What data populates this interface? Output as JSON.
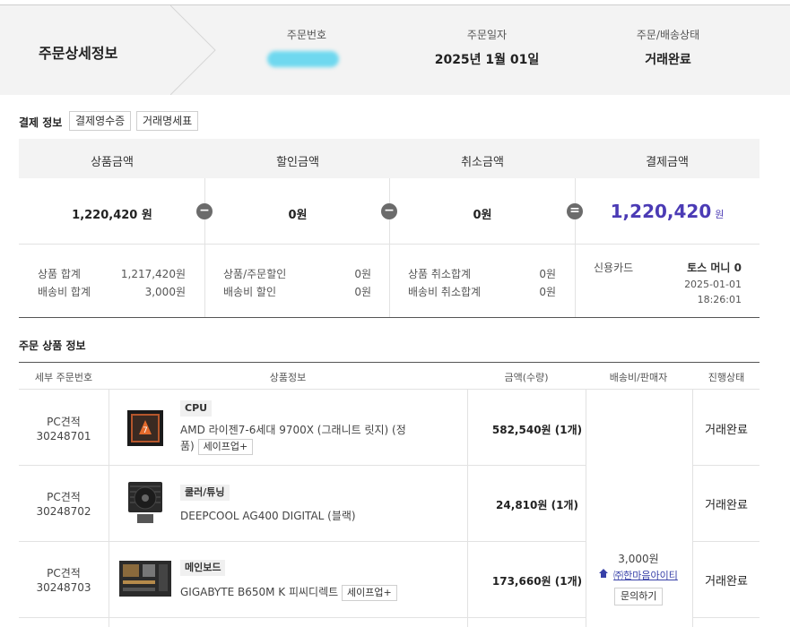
{
  "header": {
    "title": "주문상세정보",
    "order_no_label": "주문번호",
    "order_no_value": "",
    "order_date_label": "주문일자",
    "order_date_value": "2025년 1월 01일",
    "status_label": "주문/배송상태",
    "status_value": "거래완료"
  },
  "payment": {
    "title": "결제 정보",
    "receipt_button": "결제영수증",
    "statement_button": "거래명세표",
    "headers": [
      "상품금액",
      "할인금액",
      "취소금액",
      "결제금액"
    ],
    "values": {
      "product": "1,220,420 원",
      "discount": "0원",
      "cancel": "0원",
      "total": "1,220,420",
      "total_unit": "원"
    },
    "operators": [
      "−",
      "−",
      "="
    ],
    "details": {
      "product_sum_label": "상품 합계",
      "product_sum_value": "1,217,420원",
      "shipping_sum_label": "배송비 합계",
      "shipping_sum_value": "3,000원",
      "product_discount_label": "상품/주문할인",
      "product_discount_value": "0원",
      "shipping_discount_label": "배송비 할인",
      "shipping_discount_value": "0원",
      "product_cancel_label": "상품 취소합계",
      "product_cancel_value": "0원",
      "shipping_cancel_label": "배송비 취소합계",
      "shipping_cancel_value": "0원",
      "method_label": "신용카드",
      "method_value": "토스 머니 0",
      "pay_date": "2025-01-01",
      "pay_time": "18:26:01"
    }
  },
  "items": {
    "title": "주문 상품 정보",
    "columns": [
      "세부 주문번호",
      "상품정보",
      "금액(수량)",
      "배송비/판매자",
      "진행상태"
    ],
    "rows": [
      {
        "order_type": "PC견적",
        "order_no": "30248701",
        "category": "CPU",
        "name": "AMD 라이젠7-6세대 9700X (그래니트 릿지) (정품)",
        "name_line1": "AMD 라이젠7-6세대 9700X (그래니트 릿지) (정",
        "name_line2": "품)",
        "option": "세이프업+",
        "price": "582,540원 (1개)",
        "status": "거래완료"
      },
      {
        "order_type": "PC견적",
        "order_no": "30248702",
        "category": "쿨러/튜닝",
        "name": "DEEPCOOL AG400 DIGITAL (블랙)",
        "price": "24,810원 (1개)",
        "status": "거래완료"
      },
      {
        "order_type": "PC견적",
        "order_no": "30248703",
        "category": "메인보드",
        "name": "GIGABYTE B650M K 피씨디렉트",
        "option": "세이프업+",
        "price": "173,660원 (1개)",
        "status": "거래완료"
      }
    ],
    "shipping_fee": "3,000원",
    "seller_name": "㈜한마음아이티",
    "inquiry_button": "문의하기"
  }
}
